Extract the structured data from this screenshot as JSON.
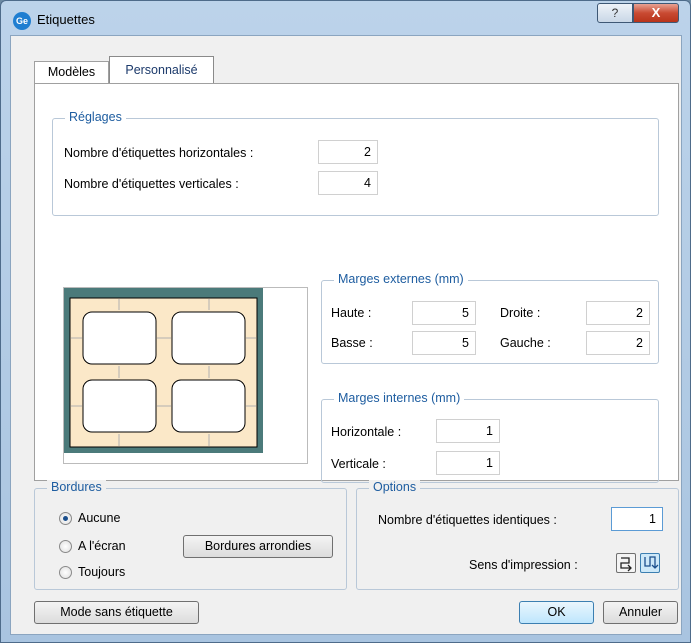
{
  "window": {
    "title": "Etiquettes",
    "icon_text": "Ge",
    "help_glyph": "?",
    "close_glyph": "X"
  },
  "tabs": [
    {
      "label": "Modèles"
    },
    {
      "label": "Personnalisé"
    }
  ],
  "reglages": {
    "title": "Réglages",
    "horizontal_label": "Nombre d'étiquettes horizontales :",
    "horizontal_value": "2",
    "vertical_label": "Nombre d'étiquettes verticales :",
    "vertical_value": "4"
  },
  "marges_externes": {
    "title": "Marges externes (mm)",
    "haute_label": "Haute :",
    "haute_value": "5",
    "droite_label": "Droite :",
    "droite_value": "2",
    "basse_label": "Basse :",
    "basse_value": "5",
    "gauche_label": "Gauche :",
    "gauche_value": "2"
  },
  "marges_internes": {
    "title": "Marges internes (mm)",
    "horizontale_label": "Horizontale :",
    "horizontale_value": "1",
    "verticale_label": "Verticale :",
    "verticale_value": "1"
  },
  "bordures": {
    "title": "Bordures",
    "options": [
      {
        "label": "Aucune",
        "selected": true
      },
      {
        "label": "A l'écran",
        "selected": false
      },
      {
        "label": "Toujours",
        "selected": false
      }
    ],
    "rounded_button": "Bordures arrondies"
  },
  "options": {
    "title": "Options",
    "identical_label": "Nombre d'étiquettes identiques :",
    "identical_value": "1",
    "print_direction_label": "Sens d'impression :"
  },
  "footer": {
    "mode_button": "Mode sans étiquette",
    "ok_button": "OK",
    "cancel_button": "Annuler"
  },
  "colors": {
    "preview_border": "#4b7a7a",
    "preview_page": "#fbe8c8"
  }
}
